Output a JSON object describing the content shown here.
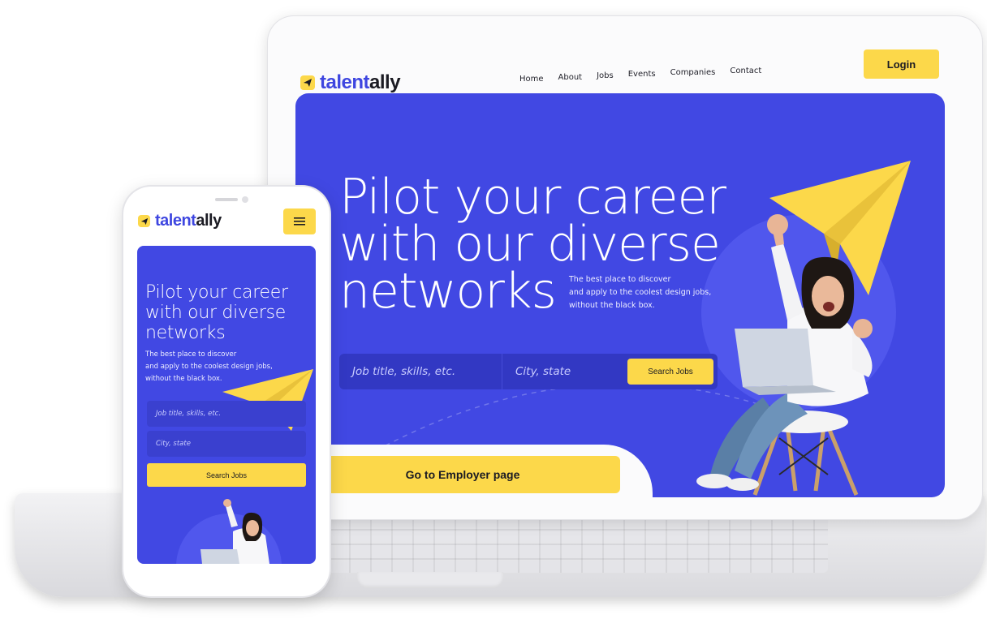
{
  "brand": {
    "name_part1": "talent",
    "name_part2": "ally",
    "accent": "#4148e3",
    "yellow": "#fcd84a"
  },
  "desktop": {
    "nav": [
      "Home",
      "About",
      "Jobs",
      "Events",
      "Companies",
      "Contact"
    ],
    "login_label": "Login",
    "hero": {
      "title": "Pilot your career with our diverse networks",
      "subtitle_lines": [
        "The best place to discover",
        "and apply to the coolest design jobs,",
        "without the black box."
      ],
      "job_placeholder": "Job title, skills, etc.",
      "city_placeholder": "City, state",
      "search_label": "Search Jobs",
      "employer_label": "Go to Employer page"
    }
  },
  "mobile": {
    "menu_icon": "hamburger-icon",
    "hero": {
      "title": "Pilot your career with our diverse networks",
      "subtitle_lines": [
        "The best place to discover",
        "and apply to the coolest design jobs,",
        "without the black box."
      ],
      "job_placeholder": "Job title, skills, etc.",
      "city_placeholder": "City, state",
      "search_label": "Search Jobs"
    }
  }
}
